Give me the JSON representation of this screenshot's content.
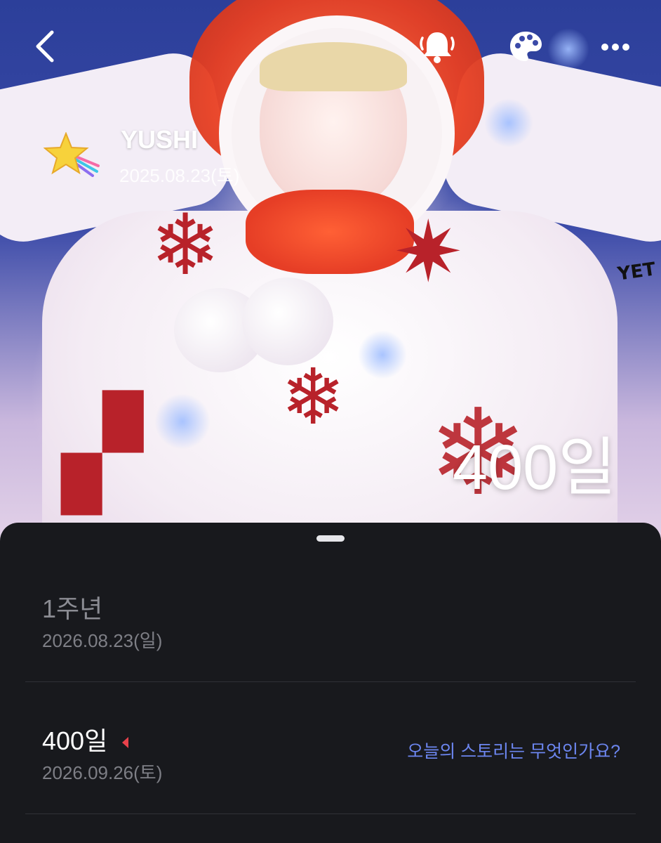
{
  "header": {
    "back_icon": "chevron-left-icon",
    "actions": [
      {
        "name": "notification-bell-icon"
      },
      {
        "name": "palette-icon"
      },
      {
        "name": "more-options-icon"
      }
    ]
  },
  "profile": {
    "name": "YUSHI",
    "start_date": "2025.08.23(토)",
    "emoji_icon": "shooting-star-icon"
  },
  "hero": {
    "day_count": "400일",
    "sticker_text": "YET"
  },
  "milestones": [
    {
      "title": "1주년",
      "date": "2026.08.23(일)",
      "is_today": false
    },
    {
      "title": "400일",
      "date": "2026.09.26(토)",
      "is_today": true,
      "story_prompt": "오늘의 스토리는 무엇인가요?"
    }
  ],
  "colors": {
    "sheet_background": "#18191d",
    "past_title": "#8b8c93",
    "current_title": "#ffffff",
    "date_text": "#7e7f86",
    "story_link": "#6c86f0",
    "today_marker": "#e8414b"
  }
}
